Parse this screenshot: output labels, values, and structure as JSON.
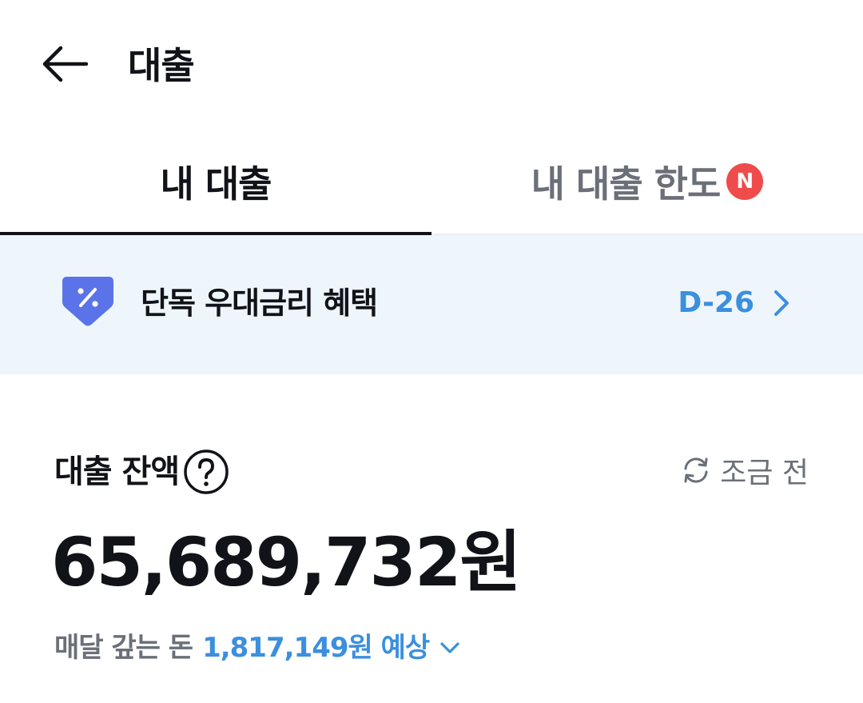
{
  "header": {
    "title": "대출",
    "back_icon": "arrow-left-icon"
  },
  "tabs": [
    {
      "label": "내 대출",
      "selected": true
    },
    {
      "label": "내 대출 한도",
      "selected": false,
      "badge": "N"
    }
  ],
  "promo": {
    "icon": "discount-tag-icon",
    "text": "단독 우대금리 혜택",
    "dday": "D-26",
    "chevron": "chevron-right-icon"
  },
  "balance": {
    "label": "대출 잔액",
    "help_icon": "question-circle-icon",
    "refresh_icon": "refresh-icon",
    "refresh_text": "조금 전",
    "amount": "65,689,732원"
  },
  "monthly": {
    "label": "매달 갚는 돈",
    "value": "1,817,149원 예상",
    "chevron": "chevron-down-icon"
  },
  "colors": {
    "accent": "#3b8fde",
    "badge": "#f04b4b",
    "promo_bg": "#eef6fc",
    "promo_icon": "#5b73e8",
    "text": "#111318",
    "muted": "#6b6f78"
  }
}
